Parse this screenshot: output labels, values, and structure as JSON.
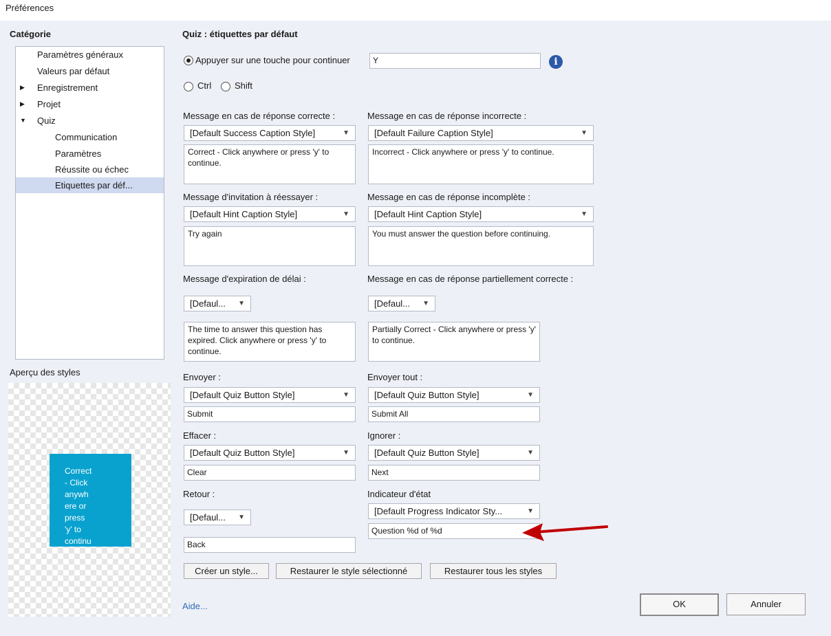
{
  "window": {
    "title": "Préférences"
  },
  "sidebar": {
    "heading": "Catégorie",
    "items": [
      {
        "label": "Paramètres généraux",
        "arrow": ""
      },
      {
        "label": "Valeurs par défaut",
        "arrow": ""
      },
      {
        "label": "Enregistrement",
        "arrow": "▶"
      },
      {
        "label": "Projet",
        "arrow": "▶"
      },
      {
        "label": "Quiz",
        "arrow": "▼"
      },
      {
        "label": "Communication",
        "arrow": ""
      },
      {
        "label": "Paramètres",
        "arrow": ""
      },
      {
        "label": "Réussite ou échec",
        "arrow": ""
      },
      {
        "label": "Etiquettes par déf...",
        "arrow": ""
      }
    ],
    "selected_index": 8
  },
  "preview": {
    "heading": "Aperçu des styles",
    "caption_lines": [
      "Correct",
      "- Click",
      "anywh",
      "ere or",
      "press",
      "'y' to",
      "continu"
    ]
  },
  "main": {
    "title": "Quiz : étiquettes par défaut",
    "press_key_label": "Appuyer sur une touche pour continuer",
    "press_key_value": "Y",
    "ctrl_label": "Ctrl",
    "shift_label": "Shift",
    "correct": {
      "label": "Message en cas de réponse correcte :",
      "style": "[Default Success Caption Style]",
      "text": "Correct - Click anywhere or press 'y' to continue."
    },
    "incorrect": {
      "label": "Message en cas de réponse incorrecte :",
      "style": "[Default Failure Caption Style]",
      "text": "Incorrect - Click anywhere or press 'y' to continue."
    },
    "retry": {
      "label": "Message d'invitation à réessayer :",
      "style": "[Default Hint Caption Style]",
      "text": "Try again"
    },
    "incomplete": {
      "label": "Message en cas de réponse incomplète :",
      "style": "[Default Hint Caption Style]",
      "text": "You must answer the question before continuing."
    },
    "timeout": {
      "label": "Message d'expiration de délai :",
      "style": "[Defaul...",
      "text": "The time to answer this question has expired. Click anywhere or press 'y' to continue."
    },
    "partial": {
      "label": "Message en cas de réponse partiellement correcte :",
      "style": "[Defaul...",
      "text": "Partially Correct - Click anywhere or press 'y' to continue."
    },
    "submit": {
      "label": "Envoyer :",
      "style": "[Default Quiz Button Style]",
      "text": "Submit"
    },
    "submit_all": {
      "label": "Envoyer tout :",
      "style": "[Default Quiz Button Style]",
      "text": "Submit All"
    },
    "clear": {
      "label": "Effacer :",
      "style": "[Default Quiz Button Style]",
      "text": "Clear"
    },
    "skip": {
      "label": "Ignorer :",
      "style": "[Default Quiz Button Style]",
      "text": "Next"
    },
    "back": {
      "label": "Retour :",
      "style": "[Defaul...",
      "text": "Back"
    },
    "progress": {
      "label": "Indicateur d'état",
      "style": "[Default Progress Indicator Sty...",
      "text": "Question %d of %d"
    },
    "create_style": "Créer un style...",
    "restore_selected": "Restaurer le style sélectionné",
    "restore_all": "Restaurer tous les styles",
    "help": "Aide...",
    "ok": "OK",
    "cancel": "Annuler"
  },
  "colors": {
    "accent_caption": "#09a2cf",
    "arrow": "#c00000",
    "panel": "#eef0f7",
    "info_icon": "#2d5aa8"
  },
  "icons": {
    "info": "info-icon",
    "dropdown": "chevron-down-icon",
    "arrow": "red-arrow-icon"
  }
}
